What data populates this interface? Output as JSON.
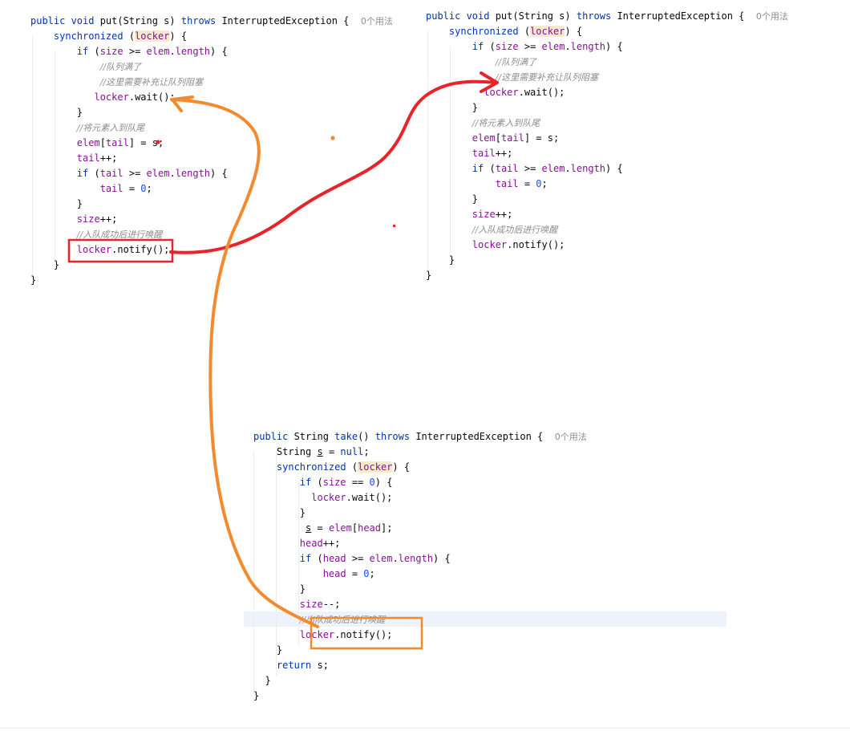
{
  "colors": {
    "keyword": "#0033b3",
    "field": "#871094",
    "number": "#1750eb",
    "comment": "#8c8c8c",
    "highlight": "#f5eacb",
    "annotation_red": "#e8242b",
    "annotation_orange": "#f28a2e"
  },
  "code_blocks": [
    {
      "id": "put-left",
      "lines": [
        [
          [
            "kw",
            "public "
          ],
          [
            "kw",
            "void "
          ],
          [
            "",
            "put(String s) "
          ],
          [
            "kw",
            "throws "
          ],
          [
            "",
            "InterruptedException {  "
          ],
          [
            "hint",
            "0个用法"
          ]
        ],
        [
          [
            "",
            "    "
          ],
          [
            "kw",
            "synchronized "
          ],
          [
            "",
            "("
          ],
          [
            "fld hl",
            "locker"
          ],
          [
            "",
            ") {"
          ]
        ],
        [
          [
            "",
            "        "
          ],
          [
            "kw",
            "if "
          ],
          [
            "",
            "("
          ],
          [
            "fld",
            "size"
          ],
          [
            "",
            " >= "
          ],
          [
            "fld",
            "elem"
          ],
          [
            "",
            "."
          ],
          [
            "fld",
            "length"
          ],
          [
            "",
            ") {"
          ]
        ],
        [
          [
            "",
            "            "
          ],
          [
            "cmt",
            "//队列满了"
          ]
        ],
        [
          [
            "",
            "            "
          ],
          [
            "cmt",
            "//这里需要补充让队列阻塞"
          ]
        ],
        [
          [
            "",
            "           "
          ],
          [
            "fld",
            "locker"
          ],
          [
            "",
            ".wait();"
          ]
        ],
        [
          [
            "",
            "        }"
          ]
        ],
        [
          [
            "",
            "        "
          ],
          [
            "cmt",
            "//将元素入到队尾"
          ]
        ],
        [
          [
            "",
            "        "
          ],
          [
            "fld",
            "elem"
          ],
          [
            "",
            "["
          ],
          [
            "fld",
            "tail"
          ],
          [
            "",
            "] = s;"
          ]
        ],
        [
          [
            "",
            "        "
          ],
          [
            "fld",
            "tail"
          ],
          [
            "",
            "++;"
          ]
        ],
        [
          [
            "",
            "        "
          ],
          [
            "kw",
            "if "
          ],
          [
            "",
            "("
          ],
          [
            "fld",
            "tail"
          ],
          [
            "",
            " >= "
          ],
          [
            "fld",
            "elem"
          ],
          [
            "",
            "."
          ],
          [
            "fld",
            "length"
          ],
          [
            "",
            ") {"
          ]
        ],
        [
          [
            "",
            "            "
          ],
          [
            "fld",
            "tail"
          ],
          [
            "",
            " = "
          ],
          [
            "num",
            "0"
          ],
          [
            "",
            ";"
          ]
        ],
        [
          [
            "",
            "        }"
          ]
        ],
        [
          [
            "",
            "        "
          ],
          [
            "fld",
            "size"
          ],
          [
            "",
            "++;"
          ]
        ],
        [
          [
            "",
            "        "
          ],
          [
            "cmt",
            "//入队成功后进行唤醒"
          ]
        ],
        [
          [
            "",
            "        "
          ],
          [
            "fld",
            "locker"
          ],
          [
            "",
            ".notify();"
          ]
        ],
        [
          [
            "",
            "    }"
          ]
        ],
        [
          [
            "",
            "}"
          ]
        ]
      ]
    },
    {
      "id": "put-right",
      "lines": [
        [
          [
            "kw",
            "public "
          ],
          [
            "kw",
            "void "
          ],
          [
            "",
            "put(String s) "
          ],
          [
            "kw",
            "throws "
          ],
          [
            "",
            "InterruptedException {  "
          ],
          [
            "hint",
            "0个用法"
          ]
        ],
        [
          [
            "",
            "    "
          ],
          [
            "kw",
            "synchronized "
          ],
          [
            "",
            "("
          ],
          [
            "fld hl",
            "locker"
          ],
          [
            "",
            ") {"
          ]
        ],
        [
          [
            "",
            "        "
          ],
          [
            "kw",
            "if "
          ],
          [
            "",
            "("
          ],
          [
            "fld",
            "size"
          ],
          [
            "",
            " >= "
          ],
          [
            "fld",
            "elem"
          ],
          [
            "",
            "."
          ],
          [
            "fld",
            "length"
          ],
          [
            "",
            ") {"
          ]
        ],
        [
          [
            "",
            "            "
          ],
          [
            "cmt",
            "//队列满了"
          ]
        ],
        [
          [
            "",
            "            "
          ],
          [
            "cmt",
            "//这里需要补充让队列阻塞"
          ]
        ],
        [
          [
            "",
            "          "
          ],
          [
            "fld",
            "locker"
          ],
          [
            "",
            ".wait();"
          ]
        ],
        [
          [
            "",
            "        }"
          ]
        ],
        [
          [
            "",
            "        "
          ],
          [
            "cmt",
            "//将元素入到队尾"
          ]
        ],
        [
          [
            "",
            "        "
          ],
          [
            "fld",
            "elem"
          ],
          [
            "",
            "["
          ],
          [
            "fld",
            "tail"
          ],
          [
            "",
            "] = s;"
          ]
        ],
        [
          [
            "",
            "        "
          ],
          [
            "fld",
            "tail"
          ],
          [
            "",
            "++;"
          ]
        ],
        [
          [
            "",
            "        "
          ],
          [
            "kw",
            "if "
          ],
          [
            "",
            "("
          ],
          [
            "fld",
            "tail"
          ],
          [
            "",
            " >= "
          ],
          [
            "fld",
            "elem"
          ],
          [
            "",
            "."
          ],
          [
            "fld",
            "length"
          ],
          [
            "",
            ") {"
          ]
        ],
        [
          [
            "",
            "            "
          ],
          [
            "fld",
            "tail"
          ],
          [
            "",
            " = "
          ],
          [
            "num",
            "0"
          ],
          [
            "",
            ";"
          ]
        ],
        [
          [
            "",
            "        }"
          ]
        ],
        [
          [
            "",
            "        "
          ],
          [
            "fld",
            "size"
          ],
          [
            "",
            "++;"
          ]
        ],
        [
          [
            "",
            "        "
          ],
          [
            "cmt",
            "//入队成功后进行唤醒"
          ]
        ],
        [
          [
            "",
            "        "
          ],
          [
            "fld",
            "locker"
          ],
          [
            "",
            ".notify();"
          ]
        ],
        [
          [
            "",
            "    }"
          ]
        ],
        [
          [
            "",
            "}"
          ]
        ]
      ]
    },
    {
      "id": "take-bottom",
      "lines": [
        [
          [
            "kw",
            "public "
          ],
          [
            "",
            "String "
          ],
          [
            "kw",
            "take"
          ],
          [
            "",
            "() "
          ],
          [
            "kw",
            "throws "
          ],
          [
            "",
            "InterruptedException {  "
          ],
          [
            "hint",
            "0个用法"
          ]
        ],
        [
          [
            "",
            "    String "
          ],
          [
            "ul",
            "s"
          ],
          [
            "",
            " = "
          ],
          [
            "kw",
            "null"
          ],
          [
            "",
            ";"
          ]
        ],
        [
          [
            "",
            "    "
          ],
          [
            "kw",
            "synchronized "
          ],
          [
            "",
            "("
          ],
          [
            "fld hl",
            "locker"
          ],
          [
            "",
            ") {"
          ]
        ],
        [
          [
            "",
            "        "
          ],
          [
            "kw",
            "if "
          ],
          [
            "",
            "("
          ],
          [
            "fld",
            "size"
          ],
          [
            "",
            " == "
          ],
          [
            "num",
            "0"
          ],
          [
            "",
            ") {"
          ]
        ],
        [
          [
            "",
            "          "
          ],
          [
            "fld",
            "locker"
          ],
          [
            "",
            ".wait();"
          ]
        ],
        [
          [
            "",
            "        }"
          ]
        ],
        [
          [
            "",
            "         "
          ],
          [
            "ul",
            "s"
          ],
          [
            "",
            " = "
          ],
          [
            "fld",
            "elem"
          ],
          [
            "",
            "["
          ],
          [
            "fld",
            "head"
          ],
          [
            "",
            "];"
          ]
        ],
        [
          [
            "",
            "        "
          ],
          [
            "fld",
            "head"
          ],
          [
            "",
            "++;"
          ]
        ],
        [
          [
            "",
            "        "
          ],
          [
            "kw",
            "if "
          ],
          [
            "",
            "("
          ],
          [
            "fld",
            "head"
          ],
          [
            "",
            " >= "
          ],
          [
            "fld",
            "elem"
          ],
          [
            "",
            "."
          ],
          [
            "fld",
            "length"
          ],
          [
            "",
            ") {"
          ]
        ],
        [
          [
            "",
            "            "
          ],
          [
            "fld",
            "head"
          ],
          [
            "",
            " = "
          ],
          [
            "num",
            "0"
          ],
          [
            "",
            ";"
          ]
        ],
        [
          [
            "",
            "        }"
          ]
        ],
        [
          [
            "",
            "        "
          ],
          [
            "fld",
            "size"
          ],
          [
            "",
            "--;"
          ]
        ],
        [
          [
            "",
            "        "
          ],
          [
            "cmt",
            "//出队成功后进行唤醒"
          ]
        ],
        [
          [
            "",
            "        "
          ],
          [
            "fld",
            "locker"
          ],
          [
            "",
            ".notify();"
          ]
        ],
        [
          [
            "",
            "    }"
          ]
        ],
        [
          [
            "",
            "    "
          ],
          [
            "kw",
            "return "
          ],
          [
            "",
            "s;"
          ]
        ],
        [
          [
            "",
            "  }"
          ]
        ],
        [
          [
            "",
            "}"
          ]
        ]
      ]
    }
  ]
}
